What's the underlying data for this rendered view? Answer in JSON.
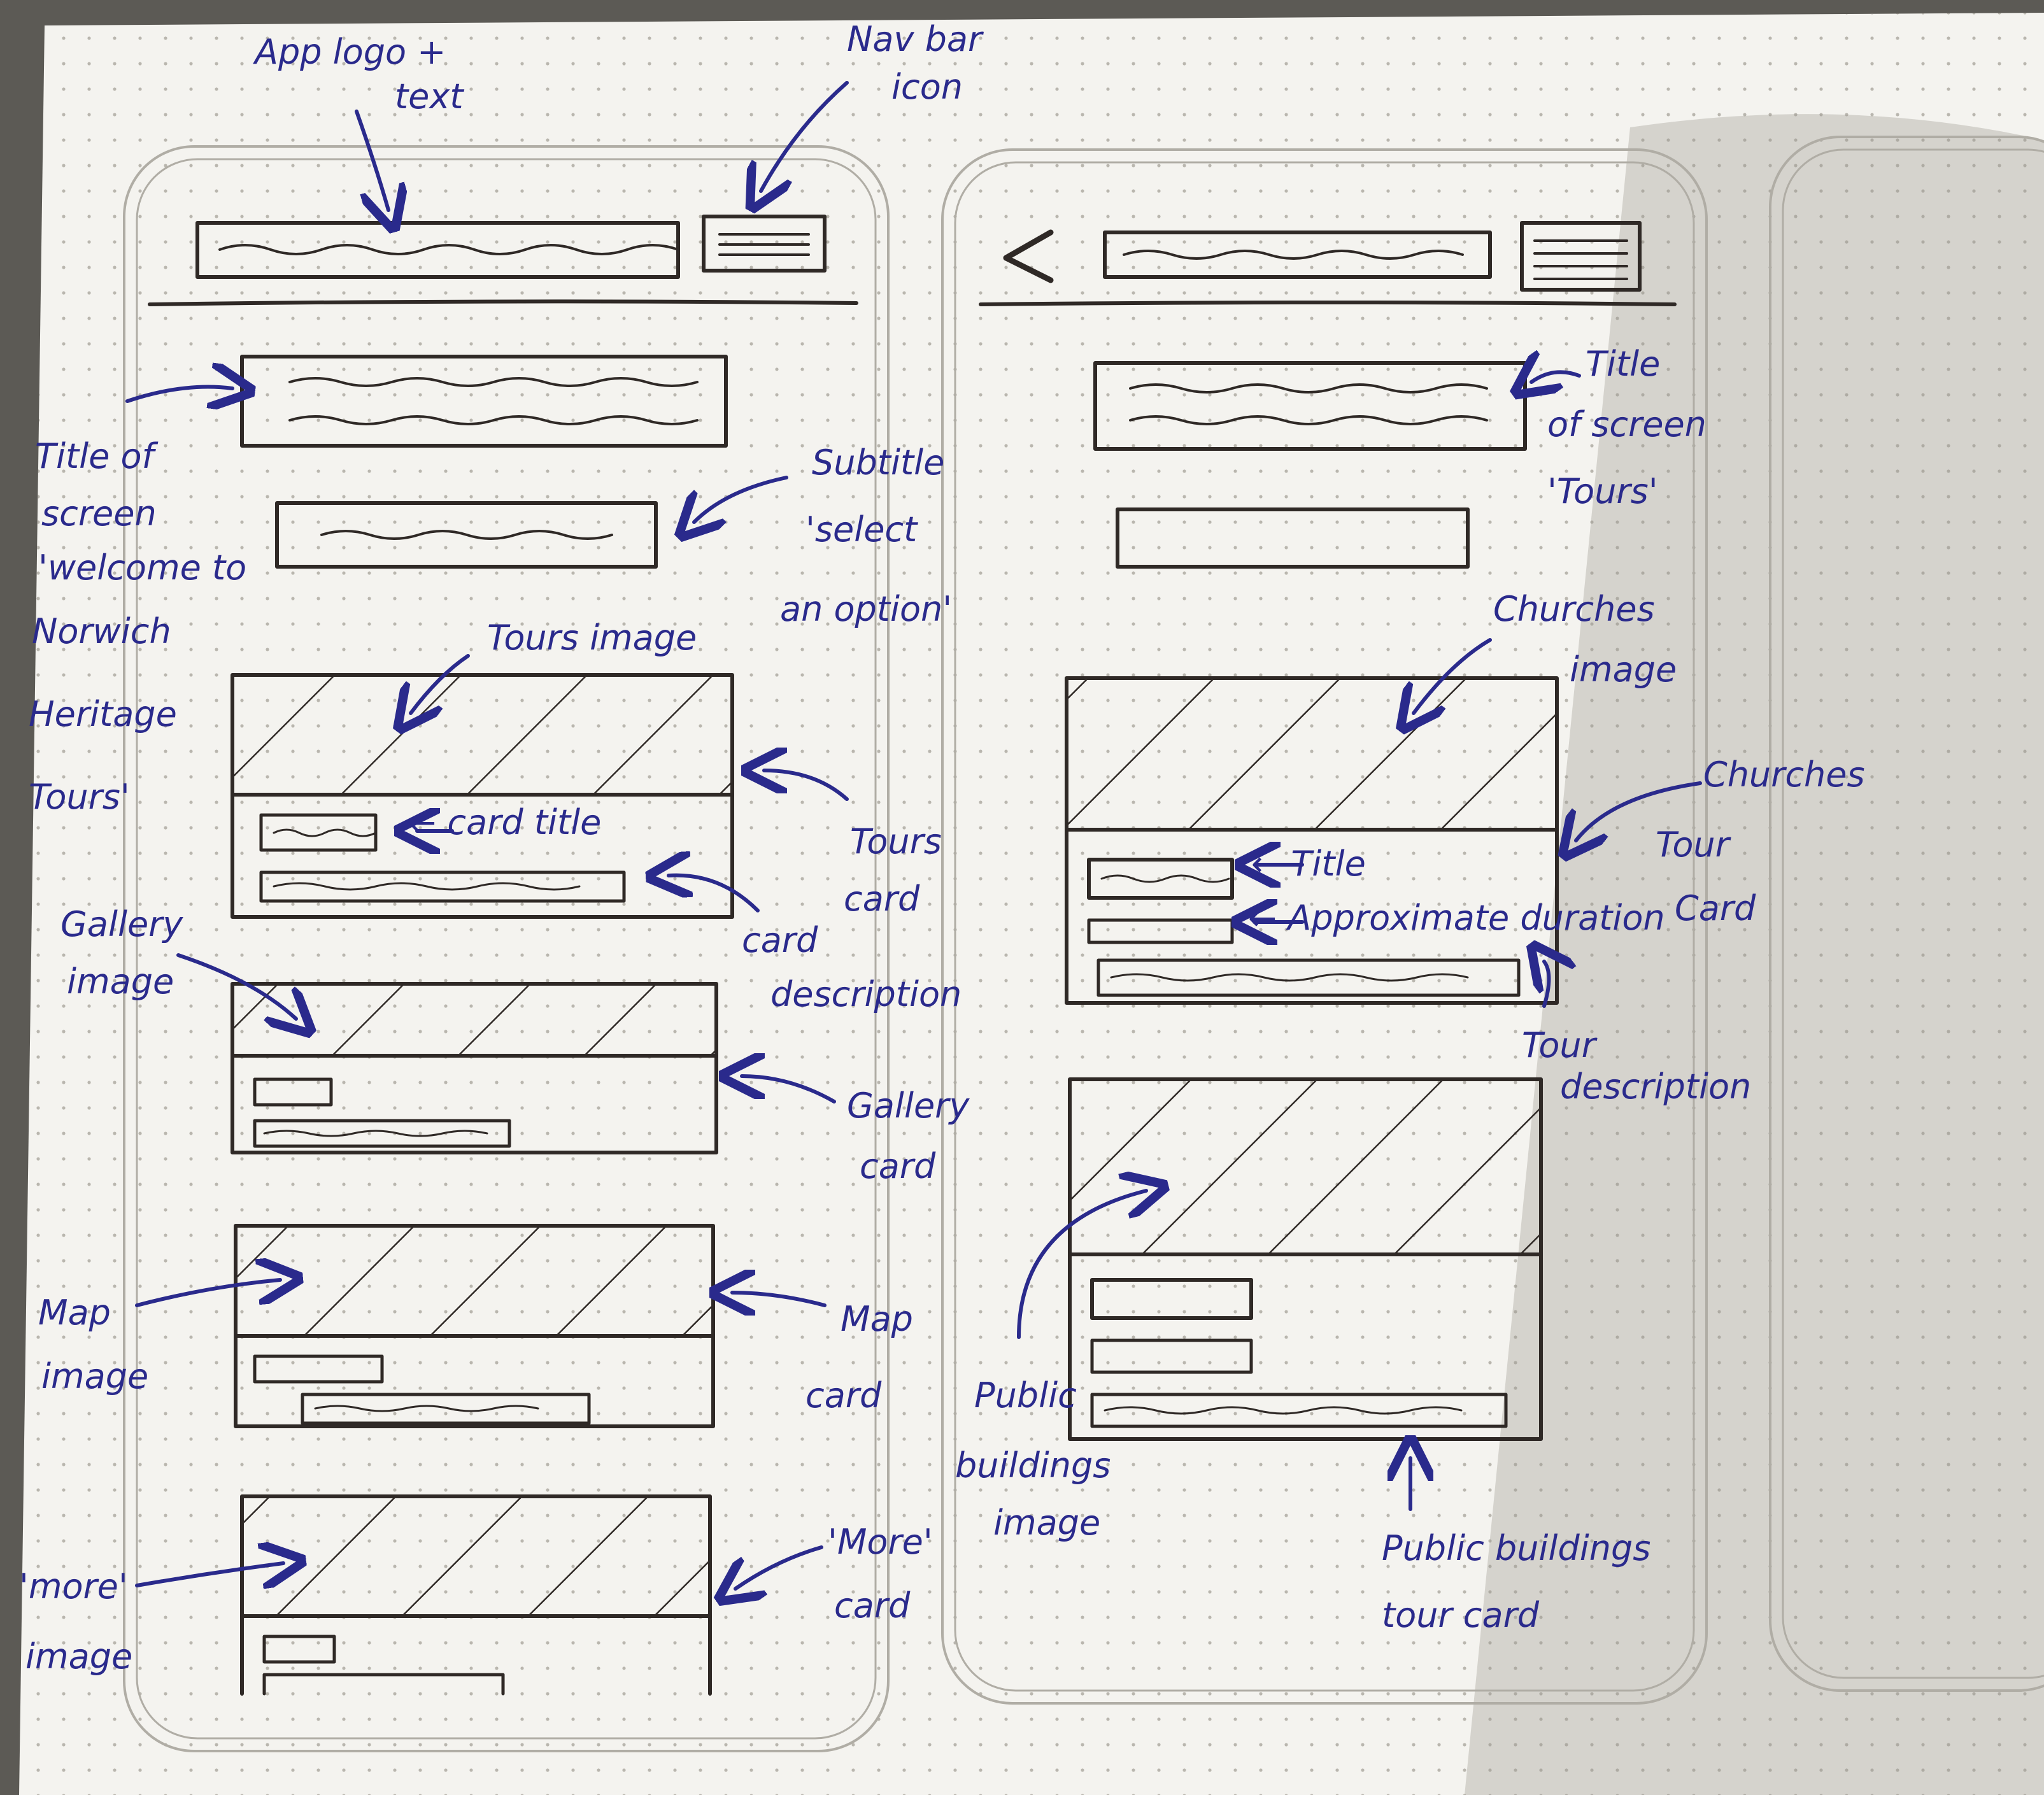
{
  "annotations": {
    "app_logo": [
      "App logo +",
      "text"
    ],
    "nav_icon": [
      "Nav bar",
      "icon"
    ],
    "title_screen_1": [
      "Title of",
      "screen",
      "'welcome to",
      "Norwich",
      "Heritage",
      "Tours'"
    ],
    "subtitle_1": [
      "Subtitle",
      "'select",
      "an option'"
    ],
    "tours_image": "Tours image",
    "card_title": "← card title",
    "tours_card": [
      "Tours",
      "card"
    ],
    "card_description": [
      "card",
      "description"
    ],
    "gallery_image": [
      "Gallery",
      "image"
    ],
    "gallery_card": [
      "Gallery",
      "card"
    ],
    "map_image": [
      "Map",
      "image"
    ],
    "map_card": [
      "Map",
      "card"
    ],
    "more_image": [
      "'more'",
      "image"
    ],
    "more_card": [
      "'More'",
      "card"
    ],
    "title_screen_2": [
      "Title",
      "of screen",
      "'Tours'"
    ],
    "churches_image": [
      "Churches",
      "image"
    ],
    "churches_card": [
      "Churches",
      "Tour",
      "Card"
    ],
    "title_label": "← Title",
    "approx_duration": "← Approximate duration",
    "tour_description": [
      "Tour",
      "description"
    ],
    "public_buildings_image": [
      "Public",
      "buildings",
      "image"
    ],
    "public_buildings_card": [
      "Public buildings",
      "tour card"
    ]
  },
  "colors": {
    "paper": "#f4f3ef",
    "ink": "#2f2926",
    "pen_blue": "#2a2a8c",
    "background": "#5c5a55"
  },
  "icons": [
    "hamburger-menu-icon",
    "back-chevron-icon",
    "arrow-icon"
  ]
}
